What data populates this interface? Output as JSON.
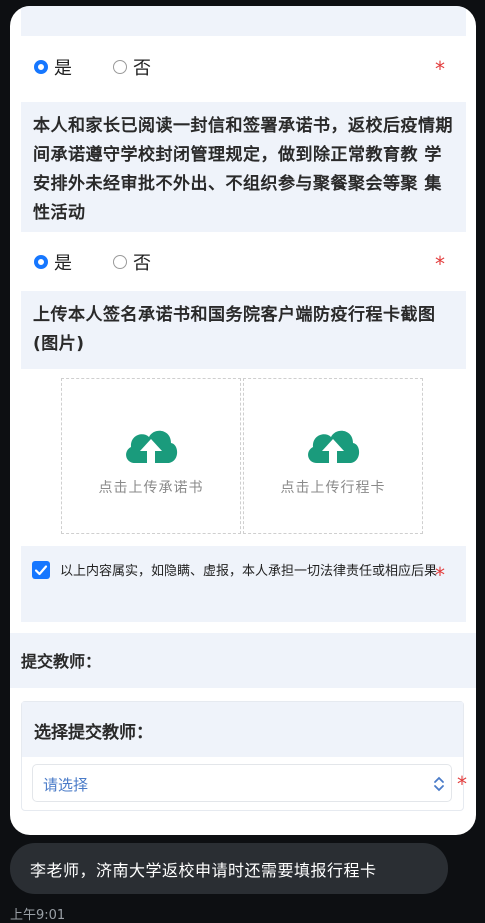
{
  "questions": [
    {
      "options": [
        "是",
        "否"
      ],
      "selected": 0,
      "required_mark": "*"
    },
    {
      "text": "本人和家长已阅读一封信和签署承诺书，返校后疫情期间承诺遵守学校封闭管理规定，做到除正常教育教 学安排外未经审批不外出、不组织参与聚餐聚会等聚 集性活动",
      "options": [
        "是",
        "否"
      ],
      "selected": 0,
      "required_mark": "*"
    },
    {
      "text": "上传本人签名承诺书和国务院客户端防疫行程卡截图 (图片)"
    }
  ],
  "uploads": [
    {
      "label": "点击上传承诺书",
      "icon": "cloud-upload-icon"
    },
    {
      "label": "点击上传行程卡",
      "icon": "cloud-upload-icon"
    }
  ],
  "declaration": {
    "text": "以上内容属实，如隐瞒、虚报，本人承担一切法律责任或相应后果",
    "checked": true,
    "required_mark": "*"
  },
  "teacher_section": {
    "heading": "提交教师：",
    "field_label": "选择提交教师：",
    "placeholder": "请选择",
    "required_mark": "*"
  },
  "chat": {
    "message": "李老师，济南大学返校申请时还需要填报行程卡",
    "time": "上午9:01"
  },
  "colors": {
    "accent": "#1677ff",
    "upload_icon": "#1a9b7c",
    "required": "#e23b3b",
    "panel_bg": "#eff3fa"
  }
}
